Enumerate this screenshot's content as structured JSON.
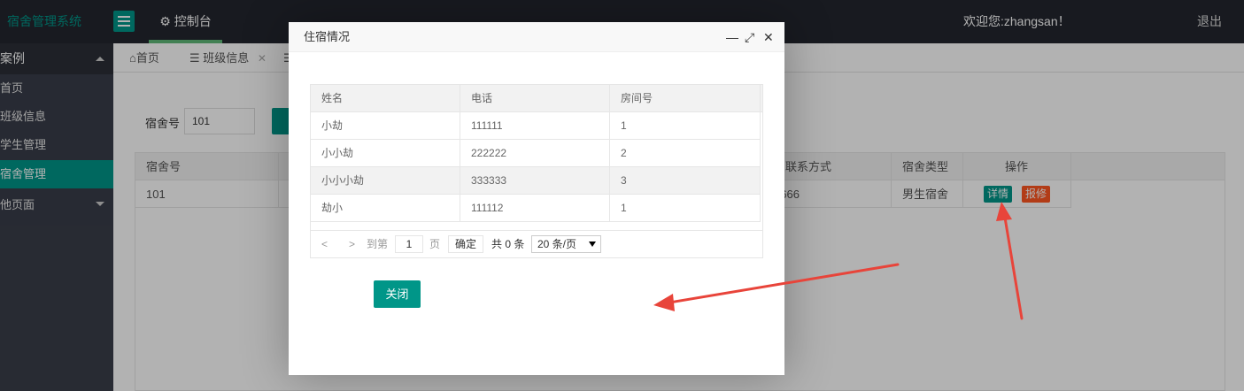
{
  "app": {
    "title": "宿舍管理系统",
    "console_label": "控制台",
    "welcome": "欢迎您:zhangsan！",
    "logout": "退出"
  },
  "sidebar": {
    "group1": "案例",
    "items": [
      "首页",
      "班级信息",
      "学生管理",
      "宿舍管理"
    ],
    "group2": "他页面",
    "active_index": 3
  },
  "tabs": [
    {
      "label": "首页"
    },
    {
      "label": "班级信息"
    }
  ],
  "search": {
    "label": "宿舍号",
    "value": "101"
  },
  "grid": {
    "columns": [
      "宿舍号",
      "东联系方式",
      "宿舍类型",
      "操作"
    ],
    "row": {
      "dorm": "101",
      "phone": "6666",
      "type": "男生宿舍"
    },
    "detail_btn": "详情",
    "repair_btn": "报修"
  },
  "modal": {
    "title": "住宿情况",
    "columns": [
      "姓名",
      "电话",
      "房间号"
    ],
    "rows": [
      {
        "name": "小劫",
        "phone": "111111",
        "room": "1"
      },
      {
        "name": "小小劫",
        "phone": "222222",
        "room": "2"
      },
      {
        "name": "小小小劫",
        "phone": "333333",
        "room": "3"
      },
      {
        "name": "劫小",
        "phone": "111112",
        "room": "1"
      }
    ],
    "pager": {
      "goto_label": "到第",
      "page_value": "1",
      "page_unit": "页",
      "confirm": "确定",
      "total": "共 0 条",
      "page_size": "20 条/页"
    },
    "close_label": "关闭"
  },
  "colors": {
    "accent": "#009688",
    "danger": "#ff5722",
    "topbar": "#23262e",
    "sidebar": "#393d49",
    "arrow": "#e8443a"
  }
}
